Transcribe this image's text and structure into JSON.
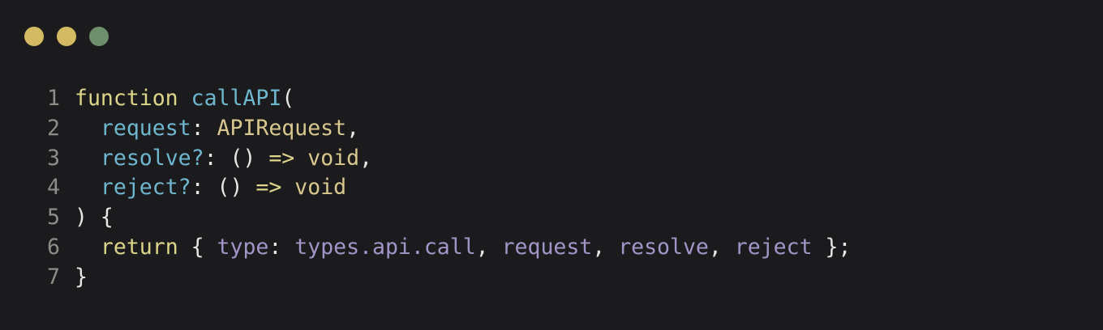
{
  "window": {
    "traffic_lights": [
      {
        "name": "close",
        "color": "#d4bb63"
      },
      {
        "name": "minimize",
        "color": "#d4bb63"
      },
      {
        "name": "maximize",
        "color": "#6d8f6b"
      }
    ]
  },
  "colors": {
    "background": "#1b1b1e",
    "line_number": "#8b8d86",
    "keyword": "#ddd58a",
    "identifier": "#6fb6cf",
    "type": "#d8c78e",
    "punctuation": "#e6e6e6",
    "property": "#a395c7",
    "plain": "#e6e6e6"
  },
  "code": {
    "lines": [
      {
        "number": "1",
        "tokens": [
          {
            "text": "function",
            "kind": "keyword"
          },
          {
            "text": " ",
            "kind": "plain"
          },
          {
            "text": "callAPI",
            "kind": "identifier"
          },
          {
            "text": "(",
            "kind": "punctuation"
          }
        ]
      },
      {
        "number": "2",
        "tokens": [
          {
            "text": "  ",
            "kind": "plain"
          },
          {
            "text": "request",
            "kind": "identifier"
          },
          {
            "text": ": ",
            "kind": "punctuation"
          },
          {
            "text": "APIRequest",
            "kind": "type"
          },
          {
            "text": ",",
            "kind": "punctuation"
          }
        ]
      },
      {
        "number": "3",
        "tokens": [
          {
            "text": "  ",
            "kind": "plain"
          },
          {
            "text": "resolve?",
            "kind": "identifier"
          },
          {
            "text": ": () ",
            "kind": "punctuation"
          },
          {
            "text": "=>",
            "kind": "keyword"
          },
          {
            "text": " ",
            "kind": "plain"
          },
          {
            "text": "void",
            "kind": "type"
          },
          {
            "text": ",",
            "kind": "punctuation"
          }
        ]
      },
      {
        "number": "4",
        "tokens": [
          {
            "text": "  ",
            "kind": "plain"
          },
          {
            "text": "reject?",
            "kind": "identifier"
          },
          {
            "text": ": () ",
            "kind": "punctuation"
          },
          {
            "text": "=>",
            "kind": "keyword"
          },
          {
            "text": " ",
            "kind": "plain"
          },
          {
            "text": "void",
            "kind": "type"
          }
        ]
      },
      {
        "number": "5",
        "tokens": [
          {
            "text": ") {",
            "kind": "punctuation"
          }
        ]
      },
      {
        "number": "6",
        "tokens": [
          {
            "text": "  ",
            "kind": "plain"
          },
          {
            "text": "return",
            "kind": "keyword"
          },
          {
            "text": " { ",
            "kind": "punctuation"
          },
          {
            "text": "type",
            "kind": "property"
          },
          {
            "text": ": ",
            "kind": "punctuation"
          },
          {
            "text": "types.api.call",
            "kind": "property"
          },
          {
            "text": ", ",
            "kind": "punctuation"
          },
          {
            "text": "request",
            "kind": "property"
          },
          {
            "text": ", ",
            "kind": "punctuation"
          },
          {
            "text": "resolve",
            "kind": "property"
          },
          {
            "text": ", ",
            "kind": "punctuation"
          },
          {
            "text": "reject",
            "kind": "property"
          },
          {
            "text": " };",
            "kind": "punctuation"
          }
        ]
      },
      {
        "number": "7",
        "tokens": [
          {
            "text": "}",
            "kind": "punctuation"
          }
        ]
      }
    ]
  }
}
